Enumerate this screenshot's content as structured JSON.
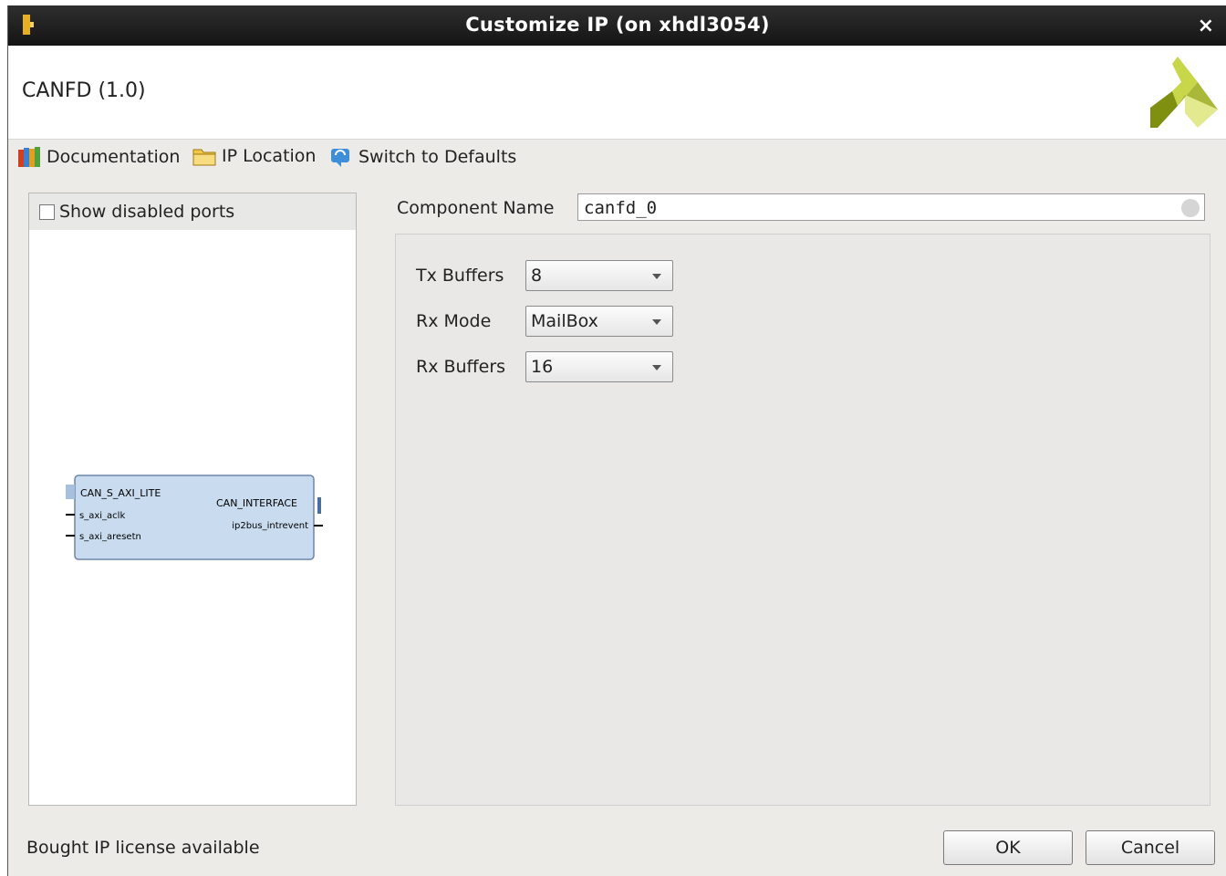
{
  "window": {
    "title": "Customize IP (on xhdl3054)",
    "close_glyph": "×"
  },
  "header": {
    "ip_name": "CANFD (1.0)",
    "logo_icon": "xilinx-logo-icon"
  },
  "toolbar": {
    "documentation": "Documentation",
    "ip_location": "IP Location",
    "switch_defaults": "Switch to Defaults"
  },
  "left_panel": {
    "show_disabled_label": "Show disabled ports",
    "show_disabled_checked": false,
    "symbol": {
      "left_ports": [
        "CAN_S_AXI_LITE",
        "s_axi_aclk",
        "s_axi_aresetn"
      ],
      "right_ports": [
        "CAN_INTERFACE",
        "ip2bus_intrevent"
      ]
    }
  },
  "component": {
    "label": "Component Name",
    "value": "canfd_0"
  },
  "params": [
    {
      "label": "Tx Buffers",
      "value": "8"
    },
    {
      "label": "Rx Mode",
      "value": "MailBox"
    },
    {
      "label": "Rx Buffers",
      "value": "16"
    }
  ],
  "footer": {
    "status": "Bought IP license available",
    "ok": "OK",
    "cancel": "Cancel"
  },
  "colors": {
    "titlebar": "#1e1e1e",
    "dialog_bg": "#ecebe8",
    "logo_dark": "#8a9a1a",
    "logo_light": "#d8e07a",
    "block_fill": "#c9dcef"
  }
}
